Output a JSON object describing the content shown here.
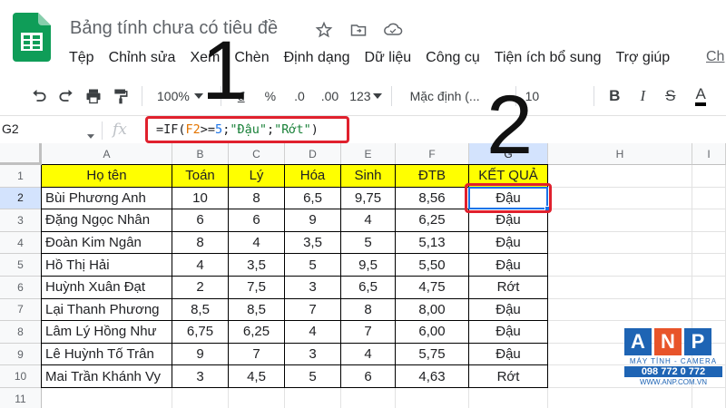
{
  "app": {
    "title": "Bảng tính chưa có tiêu đề"
  },
  "menu": {
    "items": [
      "Tệp",
      "Chỉnh sửa",
      "Xem",
      "Chèn",
      "Định dạng",
      "Dữ liệu",
      "Công cụ",
      "Tiện ích bổ sung",
      "Trợ giúp"
    ],
    "cut_label": "Ch"
  },
  "toolbar": {
    "zoom": "100%",
    "currency": "đ",
    "percent": "%",
    "decrease_decimal": ".0",
    "increase_decimal": ".00",
    "more_formats": "123",
    "font": "Mặc định (...",
    "font_size": "10",
    "bold": "B",
    "italic": "I",
    "strike": "S",
    "text_color": "A"
  },
  "formula_bar": {
    "cell_ref": "G2",
    "fx": "fx",
    "formula_prefix": "=IF(",
    "formula_ref": "F2",
    "formula_op": ">=",
    "formula_num": "5",
    "formula_sep1": ";",
    "formula_true": "\"Đậu\"",
    "formula_sep2": ";",
    "formula_false": "\"Rớt\"",
    "formula_suffix": ")"
  },
  "grid": {
    "columns": [
      "A",
      "B",
      "C",
      "D",
      "E",
      "F",
      "G",
      "H",
      "I"
    ],
    "rows": [
      "1",
      "2",
      "3",
      "4",
      "5",
      "6",
      "7",
      "8",
      "9",
      "10",
      "11"
    ],
    "header": [
      "Họ tên",
      "Toán",
      "Lý",
      "Hóa",
      "Sinh",
      "ĐTB",
      "KẾT QUẢ"
    ],
    "data": [
      [
        "Bùi Phương Anh",
        "10",
        "8",
        "6,5",
        "9,75",
        "8,56",
        "Đậu"
      ],
      [
        "Đặng Ngọc Nhân",
        "6",
        "6",
        "9",
        "4",
        "6,25",
        "Đậu"
      ],
      [
        "Đoàn Kim Ngân",
        "8",
        "4",
        "3,5",
        "5",
        "5,13",
        "Đậu"
      ],
      [
        "Hồ Thị Hải",
        "4",
        "3,5",
        "5",
        "9,5",
        "5,50",
        "Đậu"
      ],
      [
        "Huỳnh Xuân Đạt",
        "2",
        "7,5",
        "3",
        "6,5",
        "4,75",
        "Rớt"
      ],
      [
        "Lại Thanh Phương",
        "8,5",
        "8,5",
        "7",
        "8",
        "8,00",
        "Đậu"
      ],
      [
        "Lâm Lý Hồng Như",
        "6,75",
        "6,25",
        "4",
        "7",
        "6,00",
        "Đậu"
      ],
      [
        "Lê Huỳnh Tố Trân",
        "9",
        "7",
        "3",
        "4",
        "5,75",
        "Đậu"
      ],
      [
        "Mai Trần Khánh Vy",
        "3",
        "4,5",
        "5",
        "6",
        "4,63",
        "Rớt"
      ]
    ]
  },
  "annotations": {
    "step1": "1",
    "step2": "2"
  },
  "watermark": {
    "letters": [
      "A",
      "N",
      "P"
    ],
    "tagline": "MÁY TÍNH - CAMERA",
    "phone": "098 772 0 772",
    "url": "WWW.ANP.COM.VN"
  },
  "colors": {
    "header_fill": "#ffff00",
    "selection": "#1a73e8",
    "highlight": "#e0202d",
    "sheets_green": "#0f9d58"
  }
}
